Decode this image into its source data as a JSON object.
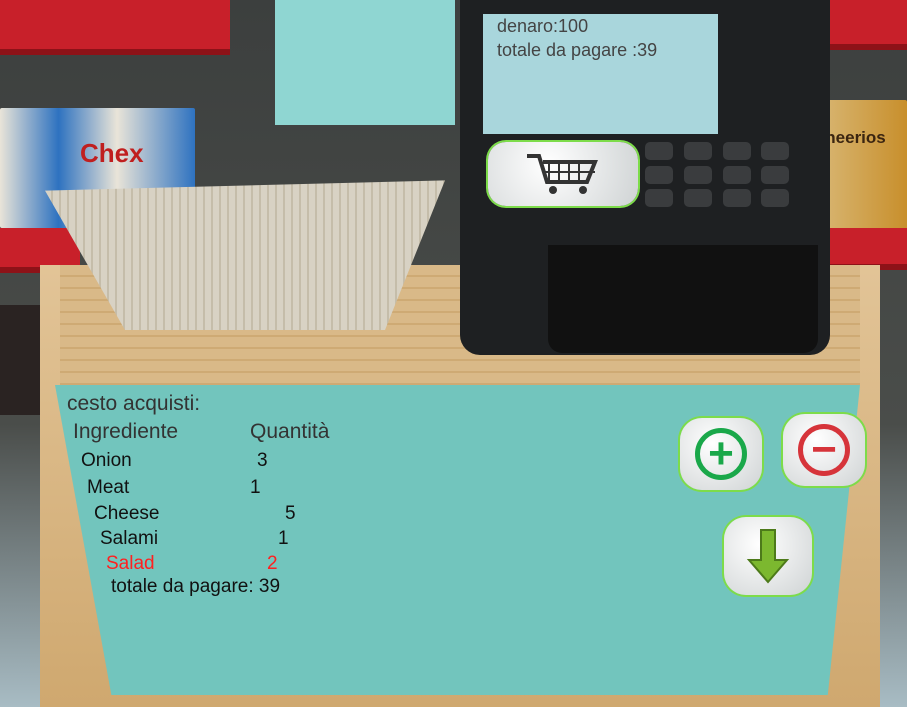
{
  "register_screen": {
    "money": "denaro:100",
    "total": "totale da pagare :39"
  },
  "basket_panel": {
    "title": "cesto acquisti:",
    "headers": {
      "ingredient": "Ingrediente",
      "quantity": "Quantità"
    },
    "items": [
      {
        "name": "Onion",
        "qty": "3",
        "selected": false
      },
      {
        "name": "Meat",
        "qty": "1",
        "selected": false
      },
      {
        "name": "Cheese",
        "qty": "5",
        "selected": false
      },
      {
        "name": "Salami",
        "qty": "1",
        "selected": false
      },
      {
        "name": "Salad",
        "qty": "2",
        "selected": true
      }
    ],
    "total": "totale da pagare: 39"
  },
  "buttons": {
    "plus": "+",
    "minus": "−"
  },
  "cereal_boxes": [
    "Chex",
    "Cheerios"
  ],
  "colors": {
    "panel": "#72c5bd",
    "selected": "#ff2020",
    "shelf": "#c8202a",
    "highlight": "#7ddc4a"
  }
}
